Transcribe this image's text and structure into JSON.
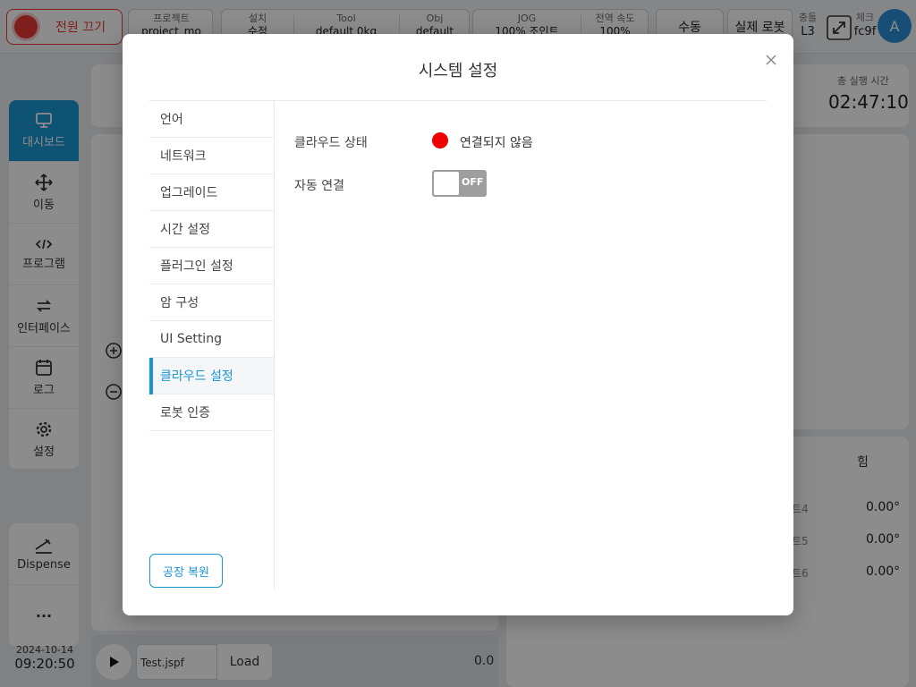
{
  "topbar": {
    "power_label": "전원 끄기",
    "project_label": "프로젝트",
    "project_value": "project_mo",
    "install_label": "설치",
    "install_value": "수정",
    "tool_label": "Tool",
    "tool_value": "default 0kg",
    "obj_label": "Obj",
    "obj_value": "default",
    "jog_label": "JOG",
    "jog_value": "100% 조인트",
    "speed_label": "전역 속도",
    "speed_value": "100%",
    "manual_label": "수동",
    "real_robot_label": "실제 로봇",
    "collision_label": "충돌",
    "collision_value": "L3",
    "check_label": "체크",
    "check_value": "fc9f",
    "avatar_letter": "A"
  },
  "sidebar": {
    "items": [
      {
        "label": "대시보드",
        "icon": "monitor-icon"
      },
      {
        "label": "이동",
        "icon": "move-icon"
      },
      {
        "label": "프로그램",
        "icon": "code-icon"
      },
      {
        "label": "인터페이스",
        "icon": "swap-icon"
      },
      {
        "label": "로그",
        "icon": "calendar-icon"
      },
      {
        "label": "설정",
        "icon": "gear-icon"
      }
    ],
    "dispense_label": "Dispense",
    "more_label": "···"
  },
  "datetime": {
    "date": "2024-10-14",
    "time": "09:20:50"
  },
  "runtime": {
    "label": "총 실행 시간",
    "value": "02:47:10"
  },
  "joints": [
    {
      "label": "트4",
      "value": "0.00°"
    },
    {
      "label": "트5",
      "value": "0.00°"
    },
    {
      "label": "트6",
      "value": "0.00°"
    }
  ],
  "force_tab": "힘",
  "player": {
    "file": "Test.jspf",
    "load_label": "Load",
    "value": "0.0"
  },
  "modal": {
    "title": "시스템 설정",
    "menu": [
      "언어",
      "네트워크",
      "업그레이드",
      "시간 설정",
      "플러그인 설정",
      "암 구성",
      "UI Setting",
      "클라우드 설정",
      "로봇 인증"
    ],
    "active_menu": "클라우드 설정",
    "factory_reset": "공장 복원",
    "cloud_status_label": "클라우드 상태",
    "cloud_status_value": "연결되지 않음",
    "cloud_status_color": "#f00000",
    "auto_connect_label": "자동 연결",
    "auto_connect_state": "OFF"
  },
  "colors": {
    "accent": "#1a95d4",
    "danger": "#e53935"
  }
}
